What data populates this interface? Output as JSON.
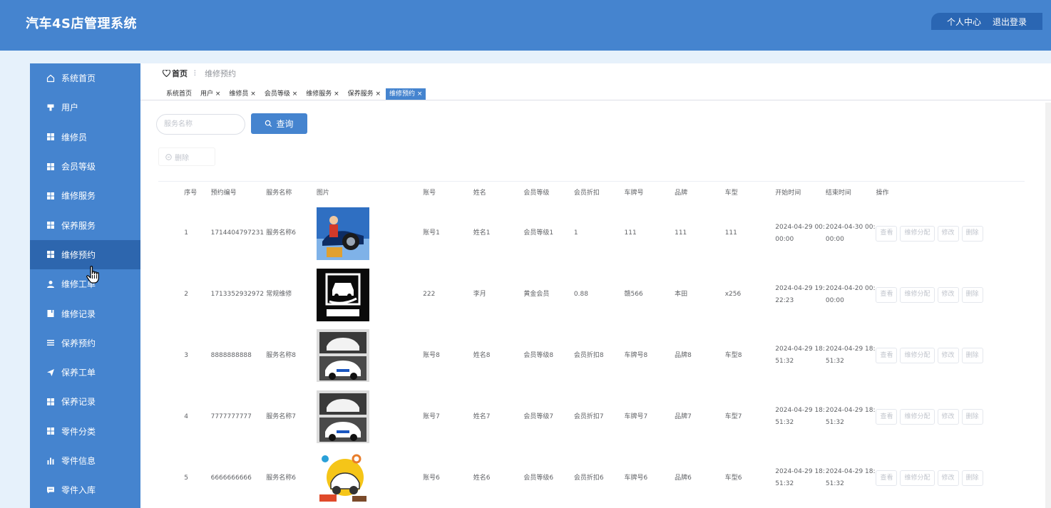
{
  "header": {
    "title": "汽车4S店管理系统",
    "profile": "个人中心",
    "logout": "退出登录"
  },
  "sidebar": {
    "items": [
      {
        "label": "系统首页",
        "icon": "home-icon"
      },
      {
        "label": "用户",
        "icon": "user-icon"
      },
      {
        "label": "维修员",
        "icon": "grid-icon"
      },
      {
        "label": "会员等级",
        "icon": "grid-icon"
      },
      {
        "label": "维修服务",
        "icon": "grid-icon"
      },
      {
        "label": "保养服务",
        "icon": "grid-icon"
      },
      {
        "label": "维修预约",
        "icon": "grid-icon",
        "active": true
      },
      {
        "label": "维修工单",
        "icon": "person-icon"
      },
      {
        "label": "维修记录",
        "icon": "book-icon"
      },
      {
        "label": "保养预约",
        "icon": "list-icon"
      },
      {
        "label": "保养工单",
        "icon": "send-icon"
      },
      {
        "label": "保养记录",
        "icon": "grid-icon"
      },
      {
        "label": "零件分类",
        "icon": "grid-icon"
      },
      {
        "label": "零件信息",
        "icon": "bar-chart-icon"
      },
      {
        "label": "零件入库",
        "icon": "message-icon"
      }
    ]
  },
  "breadcrumb": {
    "home": "首页",
    "separator": "⠇",
    "current": "维修预约"
  },
  "tabs": [
    "系统首页",
    "用户 ×",
    "维修员 ×",
    "会员等级 ×",
    "维修服务 ×",
    "保养服务 ×",
    "维修预约 ×"
  ],
  "search": {
    "placeholder": "服务名称",
    "button": "查询"
  },
  "toolbar": {
    "delete": "删除"
  },
  "table": {
    "columns": [
      "",
      "序号",
      "预约编号",
      "服务名称",
      "图片",
      "账号",
      "姓名",
      "会员等级",
      "会员折扣",
      "车牌号",
      "品牌",
      "车型",
      "开始时间",
      "结束时间",
      "操作"
    ],
    "rows": [
      {
        "no": "1",
        "code": "1714404797231",
        "service": "服务名称6",
        "image": "mechanic-tire-image",
        "account": "账号1",
        "name": "姓名1",
        "level": "会员等级1",
        "discount": "1",
        "plate": "111",
        "brand": "111",
        "model": "111",
        "start": "2024-04-29 00:00:00",
        "end": "2024-04-30 00:00:00"
      },
      {
        "no": "2",
        "code": "1713352932972",
        "service": "常规维修",
        "image": "car-care-sign-image",
        "account": "222",
        "name": "李月",
        "level": "黄金会员",
        "discount": "0.88",
        "plate": "赣566",
        "brand": "本田",
        "model": "x256",
        "start": "2024-04-29 19:22:23",
        "end": "2024-04-20 00:00:00"
      },
      {
        "no": "3",
        "code": "8888888888",
        "service": "服务名称8",
        "image": "car-lift-image",
        "account": "账号8",
        "name": "姓名8",
        "level": "会员等级8",
        "discount": "会员折扣8",
        "plate": "车牌号8",
        "brand": "品牌8",
        "model": "车型8",
        "start": "2024-04-29 18:51:32",
        "end": "2024-04-29 18:51:32"
      },
      {
        "no": "4",
        "code": "7777777777",
        "service": "服务名称7",
        "image": "car-lift-image",
        "account": "账号7",
        "name": "姓名7",
        "level": "会员等级7",
        "discount": "会员折扣7",
        "plate": "车牌号7",
        "brand": "品牌7",
        "model": "车型7",
        "start": "2024-04-29 18:51:32",
        "end": "2024-04-29 18:51:32"
      },
      {
        "no": "5",
        "code": "6666666666",
        "service": "服务名称6",
        "image": "car-tools-image",
        "account": "账号6",
        "name": "姓名6",
        "level": "会员等级6",
        "discount": "会员折扣6",
        "plate": "车牌号6",
        "brand": "品牌6",
        "model": "车型6",
        "start": "2024-04-29 18:51:32",
        "end": "2024-04-29 18:51:32"
      }
    ],
    "actions": [
      "查看",
      "维修分配",
      "修改",
      "删除"
    ]
  },
  "colors": {
    "primary": "#4584cf",
    "header_bg": "#4584cf",
    "sidebar_active": "#2d66ae",
    "page_bg": "#e6f1fb"
  }
}
